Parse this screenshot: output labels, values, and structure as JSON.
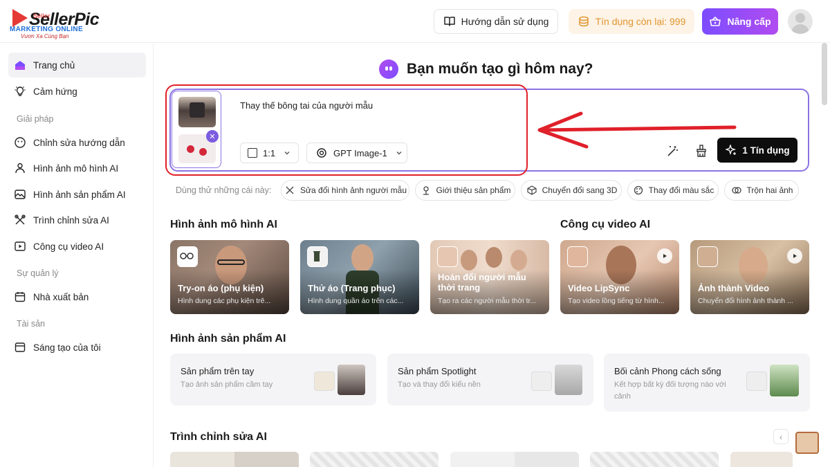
{
  "brand": {
    "name": "SellerPic",
    "overlay": "Seller",
    "tagline": "MARKETING ONLINE",
    "slogan": "Vươn Xa Cùng Bạn"
  },
  "header": {
    "guide_label": "Hướng dẫn sử dụng",
    "credits_label": "Tín dụng còn lại: 999",
    "upgrade_label": "Nâng cấp"
  },
  "sidebar": {
    "items": [
      {
        "label": "Trang chủ",
        "icon": "home-icon",
        "active": true
      },
      {
        "label": "Cảm hứng",
        "icon": "lightbulb-icon"
      },
      {
        "section": "Giải pháp"
      },
      {
        "label": "Chỉnh sửa hướng dẫn",
        "icon": "smile-icon"
      },
      {
        "label": "Hình ảnh mô hình AI",
        "icon": "person-icon"
      },
      {
        "label": "Hình ảnh sản phẩm AI",
        "icon": "image-icon"
      },
      {
        "label": "Trình chỉnh sửa AI",
        "icon": "editor-icon"
      },
      {
        "label": "Công cụ video AI",
        "icon": "video-icon"
      },
      {
        "section": "Sự quản lý"
      },
      {
        "label": "Nhà xuất bản",
        "icon": "calendar-icon"
      },
      {
        "section": "Tài sản"
      },
      {
        "label": "Sáng tạo của tôi",
        "icon": "folder-icon"
      }
    ]
  },
  "main": {
    "title": "Bạn muốn tạo gì hôm nay?",
    "prompt": {
      "text": "Thay thế bông tai của người mẫu",
      "ratio": "1:1",
      "model": "GPT Image-1",
      "generate_label": "1 Tín dụng"
    },
    "suggestions": {
      "label": "Dùng thử những cái này:",
      "chips": [
        "Sửa đổi hình ảnh người mẫu",
        "Giới thiệu sản phẩm",
        "Chuyển đổi sang 3D",
        "Thay đổi màu sắc",
        "Trộn hai ảnh"
      ]
    },
    "model_section": {
      "title": "Hình ảnh mô hình AI",
      "cards": [
        {
          "title": "Try-on áo (phụ kiện)",
          "sub": "Hình dung các phụ kiện trê..."
        },
        {
          "title": "Thử áo (Trang phục)",
          "sub": "Hình dung quần áo trên các..."
        },
        {
          "title": "Hoán đổi người mẫu thời trang",
          "sub": "Tạo ra các người mẫu thời tr..."
        }
      ]
    },
    "video_section": {
      "title": "Công cụ video AI",
      "cards": [
        {
          "title": "Video LipSync",
          "sub": "Tạo video lồng tiếng từ hình..."
        },
        {
          "title": "Ảnh thành Video",
          "sub": "Chuyển đổi hình ảnh thành ..."
        }
      ]
    },
    "product_section": {
      "title": "Hình ảnh sản phẩm AI",
      "cards": [
        {
          "title": "Sản phẩm trên tay",
          "sub": "Tạo ảnh sản phẩm cầm tay"
        },
        {
          "title": "Sản phẩm Spotlight",
          "sub": "Tạo và thay đổi kiểu nền"
        },
        {
          "title": "Bối cảnh Phong cách sống",
          "sub": "Kết hợp bất kỳ đối tượng nào với cảnh"
        }
      ]
    },
    "editor_section": {
      "title": "Trình chỉnh sửa AI"
    }
  },
  "colors": {
    "accent": "#7c4dff",
    "annotation": "#e0202a",
    "credit_text": "#e0952f",
    "credit_bg": "#fdf3e6"
  }
}
